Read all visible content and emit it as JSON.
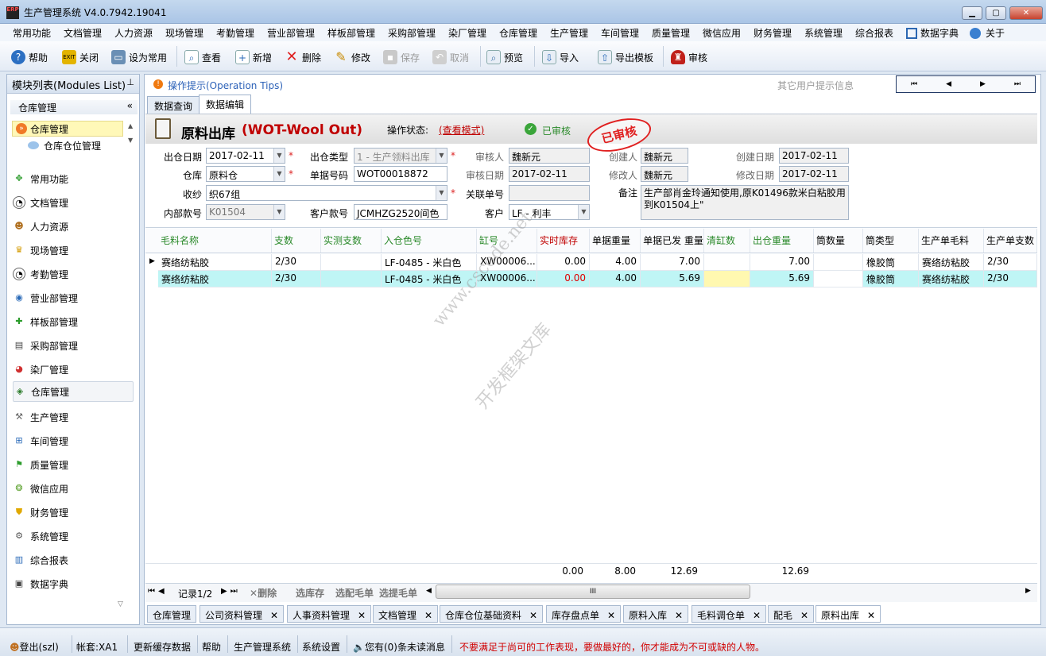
{
  "window": {
    "title": "生产管理系统 V4.0.7942.19041",
    "logo_text": "ERP"
  },
  "menu": [
    "常用功能",
    "文档管理",
    "人力资源",
    "现场管理",
    "考勤管理",
    "营业部管理",
    "样板部管理",
    "采购部管理",
    "染厂管理",
    "仓库管理",
    "生产管理",
    "车间管理",
    "质量管理",
    "微信应用",
    "财务管理",
    "系统管理",
    "综合报表",
    "数据字典",
    "关于"
  ],
  "toolbar": {
    "help": "帮助",
    "close": "关闭",
    "set_common": "设为常用",
    "view": "查看",
    "add": "新增",
    "delete": "删除",
    "edit": "修改",
    "save": "保存",
    "cancel": "取消",
    "preview": "预览",
    "import": "导入",
    "export_template": "导出模板",
    "audit": "审核"
  },
  "sidebar": {
    "title": "模块列表(Modules List)",
    "group": "仓库管理",
    "tree": [
      "仓库管理",
      "仓库仓位管理"
    ],
    "items": [
      "常用功能",
      "文档管理",
      "人力资源",
      "现场管理",
      "考勤管理",
      "营业部管理",
      "样板部管理",
      "采购部管理",
      "染厂管理",
      "仓库管理",
      "生产管理",
      "车间管理",
      "质量管理",
      "微信应用",
      "财务管理",
      "系统管理",
      "综合报表",
      "数据字典"
    ]
  },
  "tips": {
    "label": "操作提示(Operation Tips)",
    "other": "其它用户提示信息"
  },
  "tabs": [
    "数据查询",
    "数据编辑"
  ],
  "form": {
    "title": "原料出库",
    "subtitle": "(WOT-Wool Out)",
    "op_status_label": "操作状态:",
    "op_status_link": "(查看模式)",
    "audited": "已审核",
    "stamp": "已审核",
    "fields": {
      "out_date": {
        "label": "出仓日期",
        "value": "2017-02-11"
      },
      "out_type": {
        "label": "出仓类型",
        "value": "1 - 生产领料出库"
      },
      "auditor": {
        "label": "审核人",
        "value": "魏新元"
      },
      "creator": {
        "label": "创建人",
        "value": "魏新元"
      },
      "created_date": {
        "label": "创建日期",
        "value": "2017-02-11"
      },
      "warehouse": {
        "label": "仓库",
        "value": "原料仓"
      },
      "doc_no": {
        "label": "单据号码",
        "value": "WOT00018872"
      },
      "audit_date": {
        "label": "审核日期",
        "value": "2017-02-11"
      },
      "modifier": {
        "label": "修改人",
        "value": "魏新元"
      },
      "modified_date": {
        "label": "修改日期",
        "value": "2017-02-11"
      },
      "receiver": {
        "label": "收纱",
        "value": "织67组"
      },
      "related_no": {
        "label": "关联单号",
        "value": ""
      },
      "remark": {
        "label": "备注",
        "value": "生产部肖金玲通知使用,原K01496款米白粘胶用到K01504上\""
      },
      "internal_no": {
        "label": "内部款号",
        "value": "K01504"
      },
      "customer_no": {
        "label": "客户款号",
        "value": "JCMHZG2520间色"
      },
      "customer": {
        "label": "客户",
        "value": "LF - 利丰"
      }
    }
  },
  "grid": {
    "headers": [
      "毛料名称",
      "支数",
      "实测支数",
      "入仓色号",
      "缸号",
      "实时库存",
      "单据重量",
      "单据已发 重量",
      "清缸数",
      "出仓重量",
      "筒数量",
      "筒类型",
      "生产单毛料",
      "生产单支数"
    ],
    "rows": [
      [
        "赛络纺粘胶",
        "2/30",
        "",
        "LF-0485 - 米白色",
        "XW00006...",
        "0.00",
        "4.00",
        "7.00",
        "",
        "7.00",
        "",
        "橡胶筒",
        "赛络纺粘胶",
        "2/30"
      ],
      [
        "赛络纺粘胶",
        "2/30",
        "",
        "LF-0485 - 米白色",
        "XW00006...",
        "0.00",
        "4.00",
        "5.69",
        "",
        "5.69",
        "",
        "橡胶筒",
        "赛络纺粘胶",
        "2/30"
      ]
    ],
    "totals": {
      "stock": "0.00",
      "weight": "8.00",
      "issued": "12.69",
      "out": "12.69"
    }
  },
  "nav": {
    "record": "记录1/2",
    "delete": "删除",
    "select_stock": "选库存",
    "select_wool": "选配毛单",
    "select_wool2": "选提毛单"
  },
  "bottom_tabs": [
    "仓库管理",
    "公司资料管理",
    "人事资料管理",
    "文档管理",
    "仓库仓位基础资料",
    "库存盘点单",
    "原料入库",
    "毛料调仓单",
    "配毛",
    "原料出库"
  ],
  "watermark": [
    "www.cscode.net",
    "开发框架文库"
  ],
  "status": {
    "login": "登出(szl)",
    "account": "帐套:XA1",
    "refresh": "更新缓存数据",
    "help": "帮助",
    "system": "生产管理系统",
    "settings": "系统设置",
    "messages": "您有(0)条未读消息",
    "slogan": "不要满足于尚可的工作表现，要做最好的，你才能成为不可或缺的人物。"
  },
  "colors": {
    "title_red": "#c00000",
    "slogan_red": "#d10000",
    "selected_row": "#bff5f5",
    "yellow_cell": "#fff8b0",
    "header_green": "#2b8a2b"
  }
}
